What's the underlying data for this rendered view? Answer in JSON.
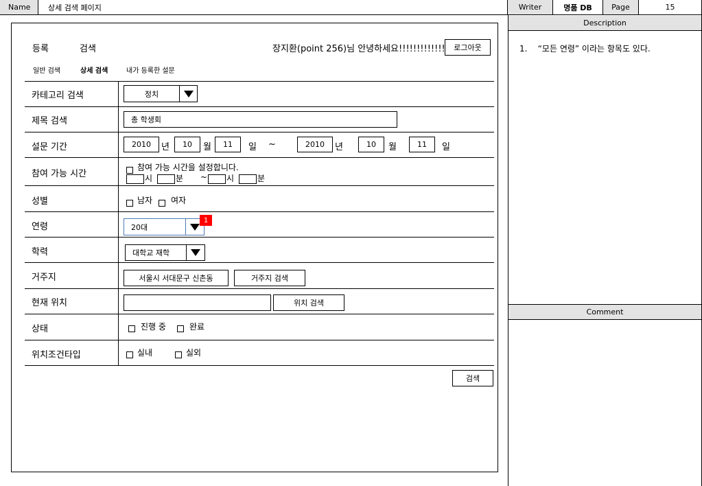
{
  "header": {
    "name_label": "Name",
    "name_value": "상세 검색 페이지",
    "writer_label": "Writer",
    "writer_value": "명품 DB",
    "page_label": "Page",
    "page_value": "15"
  },
  "description": {
    "title": "Description",
    "items": [
      "1.    “모든 연령” 이라는 항목도 있다."
    ]
  },
  "comment": {
    "title": "Comment"
  },
  "topnav": {
    "register": "등록",
    "search": "검색",
    "greeting": "장지환(point 256)님 안녕하세요!!!!!!!!!!!!!!!",
    "logout": "로그아웃"
  },
  "tabs": {
    "general": "일반 검색",
    "detail": "상세 검색",
    "mine": "내가 등록한 설문"
  },
  "form": {
    "category": {
      "label": "카테고리 검색",
      "value": "정치"
    },
    "title": {
      "label": "제목 검색",
      "value": "총 학생회"
    },
    "period": {
      "label": "설문 기간",
      "from_year": "2010",
      "year_unit": "년",
      "from_month": "10",
      "month_unit": "월",
      "from_day": "11",
      "day_unit": "일",
      "tilde": "~",
      "to_year": "2010",
      "to_month": "10",
      "to_day": "11"
    },
    "time": {
      "label": "참여 가능 시간",
      "checkbox_label": "참여 가능 시간을 설정합니다.",
      "hour_unit": "시",
      "minute_unit": "분",
      "tilde": "~"
    },
    "gender": {
      "label": "성별",
      "male": "남자",
      "female": "여자"
    },
    "age": {
      "label": "연령",
      "value": "20대",
      "marker": "1"
    },
    "education": {
      "label": "학력",
      "value": "대학교 재학"
    },
    "residence": {
      "label": "거주지",
      "value": "서울시 서대문구 신촌동",
      "button": "거주지 검색"
    },
    "location": {
      "label": "현재 위치",
      "value": "",
      "button": "위치 검색"
    },
    "status": {
      "label": "상태",
      "ongoing": "진행 중",
      "done": "완료"
    },
    "location_type": {
      "label": "위치조건타입",
      "indoor": "실내",
      "outdoor": "실외"
    },
    "submit": "검색"
  },
  "colors": {
    "header_gray": "#e3e3e3",
    "marker_red": "#ff0000",
    "select_border_blue": "#4a7ab5"
  }
}
